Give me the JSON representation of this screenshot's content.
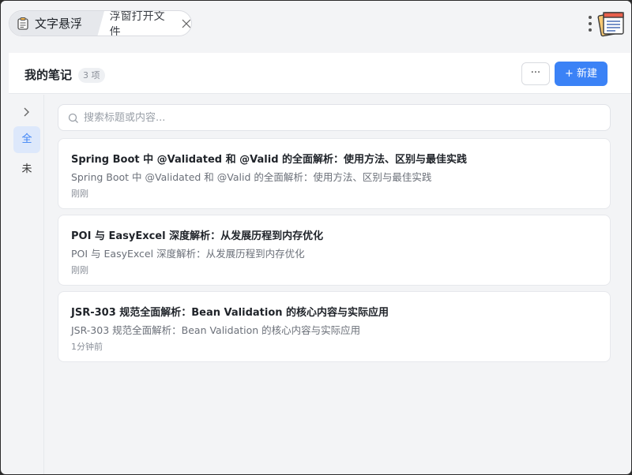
{
  "tabs": {
    "active_label": "文字悬浮",
    "inactive_label": "浮窗打开文件"
  },
  "header": {
    "title": "我的笔记",
    "count": "3 项",
    "more_label": "···",
    "new_label": "+ 新建"
  },
  "sidebar": {
    "filter_all": "全",
    "filter_unfiled": "未"
  },
  "search": {
    "placeholder": "搜索标题或内容...",
    "value": ""
  },
  "notes": [
    {
      "title": "Spring Boot 中 @Validated 和 @Valid 的全面解析：使用方法、区别与最佳实践",
      "preview": "Spring Boot 中 @Validated 和 @Valid 的全面解析：使用方法、区别与最佳实践",
      "time": "刚刚"
    },
    {
      "title": "POI 与 EasyExcel 深度解析：从发展历程到内存优化",
      "preview": "POI 与 EasyExcel 深度解析：从发展历程到内存优化",
      "time": "刚刚"
    },
    {
      "title": "JSR-303 规范全面解析：Bean Validation 的核心内容与实际应用",
      "preview": "JSR-303 规范全面解析：Bean Validation 的核心内容与实际应用",
      "time": "1分钟前"
    }
  ],
  "colors": {
    "accent": "#3b82f6",
    "background": "#f3f4f6",
    "card": "#ffffff"
  }
}
